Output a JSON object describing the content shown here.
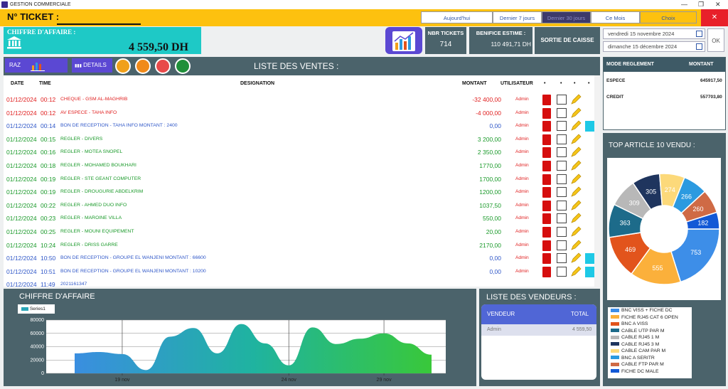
{
  "window": {
    "title": "GESTION COMMERCIALE"
  },
  "header": {
    "ticket_label": "N° TICKET :",
    "periods": [
      "Aujourd'hui",
      "Dernier 7 jours",
      "Dernier 30 jours",
      "Ce Mois",
      "Choix"
    ],
    "close": "✕"
  },
  "ca": {
    "label": "CHIFFRE D'AFFAIRE :",
    "value": "4 559,50 DH"
  },
  "stats": {
    "nbr_label": "NBR TICKETS",
    "nbr_value": "714",
    "benef_label": "BENIFICE ESTIME :",
    "benef_value": "110 491,71 DH",
    "sortie_label": "SORTIE DE CAISSE"
  },
  "dates": {
    "from": "vendredi 15 novembre 2024",
    "to": "dimanche 15 décembre 2024",
    "ok": "OK"
  },
  "sales": {
    "title": "LISTE DES VENTES :",
    "raz": "RAZ",
    "details": "DETAILS ...",
    "headers": {
      "date": "DATE",
      "time": "TIME",
      "designation": "DESIGNATION",
      "montant": "MONTANT",
      "utilisateur": "UTILISATEUR",
      "a": "•",
      "b": "•",
      "c": "•",
      "d": "•"
    },
    "rows": [
      {
        "date": "01/12/2024",
        "time": "00:12",
        "des": "CHEQUE - GSM AL-MAGHRIB",
        "montant": "-32 400,00",
        "user": "Admin",
        "kind": "red"
      },
      {
        "date": "01/12/2024",
        "time": "00:12",
        "des": "AV ESPECE - TAHA INFO",
        "montant": "-4 000,00",
        "user": "Admin",
        "kind": "red"
      },
      {
        "date": "01/12/2024",
        "time": "00:14",
        "des": "BON DE RECEPTION - TAHA INFO  MONTANT : 2400",
        "montant": "0,00",
        "user": "Admin",
        "kind": "blue"
      },
      {
        "date": "01/12/2024",
        "time": "00:15",
        "des": "REGLER - DIVERS",
        "montant": "3 200,00",
        "user": "Admin",
        "kind": "green"
      },
      {
        "date": "01/12/2024",
        "time": "00:16",
        "des": "REGLER - MOTEA SNOPEL",
        "montant": "2 350,00",
        "user": "Admin",
        "kind": "green"
      },
      {
        "date": "01/12/2024",
        "time": "00:18",
        "des": "REGLER - MOHAMED BOUKHARI",
        "montant": "1770,00",
        "user": "Admin",
        "kind": "green"
      },
      {
        "date": "01/12/2024",
        "time": "00:19",
        "des": "REGLER - STE GEANT COMPUTER",
        "montant": "1700,00",
        "user": "Admin",
        "kind": "green"
      },
      {
        "date": "01/12/2024",
        "time": "00:19",
        "des": "REGLER - DROUGURIE ABDELKRIM",
        "montant": "1200,00",
        "user": "Admin",
        "kind": "green"
      },
      {
        "date": "01/12/2024",
        "time": "00:22",
        "des": "REGLER - AHMED DUO INFO",
        "montant": "1037,50",
        "user": "Admin",
        "kind": "green"
      },
      {
        "date": "01/12/2024",
        "time": "00:23",
        "des": "REGLER - MAROINE VILLA",
        "montant": "550,00",
        "user": "Admin",
        "kind": "green"
      },
      {
        "date": "01/12/2024",
        "time": "00:25",
        "des": "REGLER - MOUNI EQUIPEMENT",
        "montant": "20,00",
        "user": "Admin",
        "kind": "green"
      },
      {
        "date": "01/12/2024",
        "time": "10:24",
        "des": "REGLER - DRISS GARRE",
        "montant": "2170,00",
        "user": "Admin",
        "kind": "green"
      },
      {
        "date": "01/12/2024",
        "time": "10:50",
        "des": "BON DE RECEPTION - GROUPE EL WANJENI MONTANT : 66600",
        "montant": "0,00",
        "user": "Admin",
        "kind": "blue"
      },
      {
        "date": "01/12/2024",
        "time": "10:51",
        "des": "BON DE RECEPTION - GROUPE EL WANJENI MONTANT : 10200",
        "montant": "0,00",
        "user": "Admin",
        "kind": "blue"
      },
      {
        "date": "01/12/2024",
        "time": "11:49",
        "des": "2021161347",
        "montant": "",
        "user": "",
        "kind": "blue"
      }
    ]
  },
  "colors": {
    "red": "#e02020",
    "green": "#1a9a2a",
    "blue": "#2f57c8"
  },
  "mode": {
    "h1": "MODE REGLEMENT",
    "h2": "MONTANT",
    "rows": [
      {
        "name": "ESPECE",
        "val": "645917,50"
      },
      {
        "name": "CREDIT",
        "val": "557703,80"
      }
    ]
  },
  "top": {
    "title": "TOP ARTICLE 10 VENDU :",
    "slices": [
      {
        "v": 753,
        "c": "#3d8ee8"
      },
      {
        "v": 555,
        "c": "#fbb03b"
      },
      {
        "v": 469,
        "c": "#e2541c"
      },
      {
        "v": 363,
        "c": "#1d6b8a"
      },
      {
        "v": 309,
        "c": "#b8b8b8"
      },
      {
        "v": 305,
        "c": "#1f355e"
      },
      {
        "v": 274,
        "c": "#fcd97a"
      },
      {
        "v": 266,
        "c": "#2c9ae0"
      },
      {
        "v": 260,
        "c": "#cf6a45"
      },
      {
        "v": 182,
        "c": "#1258d6"
      }
    ],
    "legend": [
      "BNC VISS + FICHE DC",
      "FICHE RJ45 CAT 6 OPEN",
      "BNC A VISS",
      "CABLE UTP PAR M",
      "CABLE RJ45  1 M",
      "CABLE RJ45  3 M",
      "CABLE CAM PAR M",
      "BNC A SERITR",
      "CABLE FTP PAR M",
      "FICHE DC MALE"
    ],
    "legend_colors": [
      "#3d8ee8",
      "#fbb03b",
      "#e2541c",
      "#1d6b8a",
      "#b8b8b8",
      "#1f355e",
      "#fcd97a",
      "#2c9ae0",
      "#cf6a45",
      "#1258d6"
    ]
  },
  "vendeurs": {
    "title": "LISTE DES VENDEURS :",
    "h1": "VENDEUR",
    "h2": "TOTAL",
    "rows": [
      {
        "name": "Admin",
        "total": "4 559,50"
      }
    ]
  },
  "chart_data": {
    "type": "area",
    "title": "CHIFFRE D'AFFAIRE",
    "series": [
      {
        "name": "Series1",
        "values": [
          30000,
          32000,
          29000,
          5000,
          55000,
          68000,
          30000,
          74000,
          45000,
          12000,
          69000,
          44000,
          52000,
          60000,
          45000,
          28000
        ]
      }
    ],
    "x": [
      "",
      "",
      "19 nov",
      "",
      "",
      "",
      "",
      "",
      "",
      "24 nov",
      "",
      "",
      "",
      "29 nov",
      "",
      ""
    ],
    "ylim": [
      0,
      80000
    ],
    "yticks": [
      "80000",
      "60000",
      "40000",
      "20000",
      "0"
    ],
    "xticks": [
      "19 nov",
      "24 nov",
      "29 nov"
    ]
  }
}
